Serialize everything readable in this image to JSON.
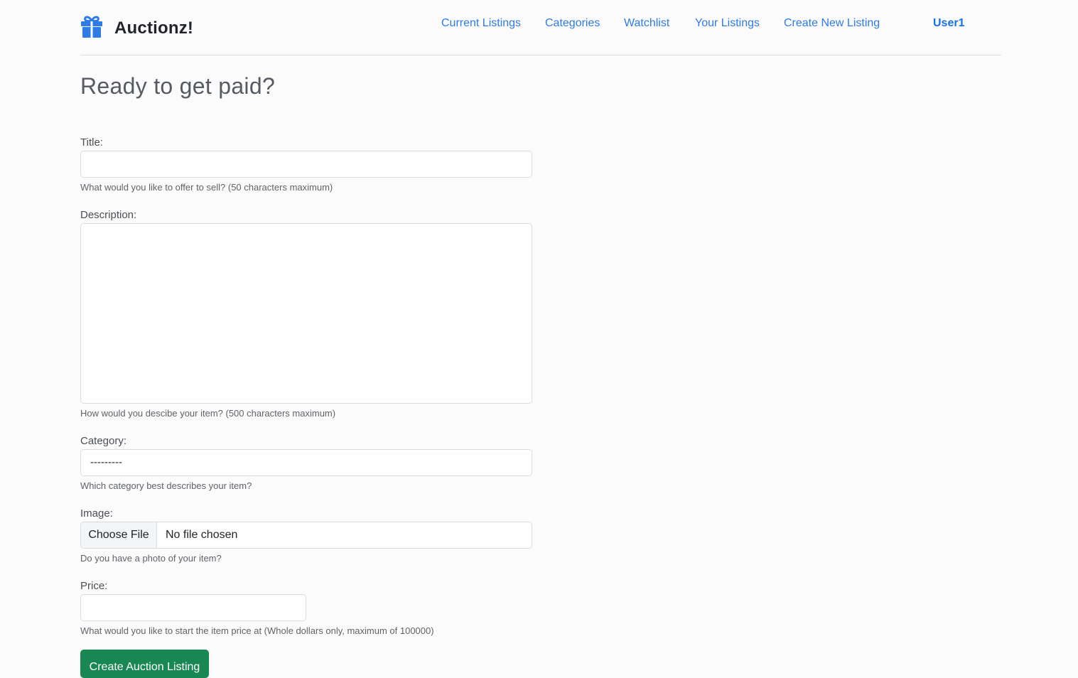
{
  "brand": {
    "name": "Auctionz!",
    "icon": "gift-icon",
    "color": "#2f7be6"
  },
  "nav": {
    "items": [
      "Current Listings",
      "Categories",
      "Watchlist",
      "Your Listings",
      "Create New Listing"
    ],
    "user": "User1"
  },
  "page": {
    "heading": "Ready to get paid?"
  },
  "form": {
    "title": {
      "label": "Title:",
      "value": "",
      "help": "What would you like to offer to sell? (50 characters maximum)"
    },
    "description": {
      "label": "Description:",
      "value": "",
      "help": "How would you descibe your item? (500 characters maximum)"
    },
    "category": {
      "label": "Category:",
      "selected": "---------",
      "help": "Which category best describes your item?"
    },
    "image": {
      "label": "Image:",
      "button": "Choose File",
      "status": "No file chosen",
      "help": "Do you have a photo of your item?"
    },
    "price": {
      "label": "Price:",
      "value": "",
      "help": "What would you like to start the item price at (Whole dollars only, maximum of 100000)"
    },
    "submit": "Create Auction Listing",
    "submit_color": "#198754"
  }
}
